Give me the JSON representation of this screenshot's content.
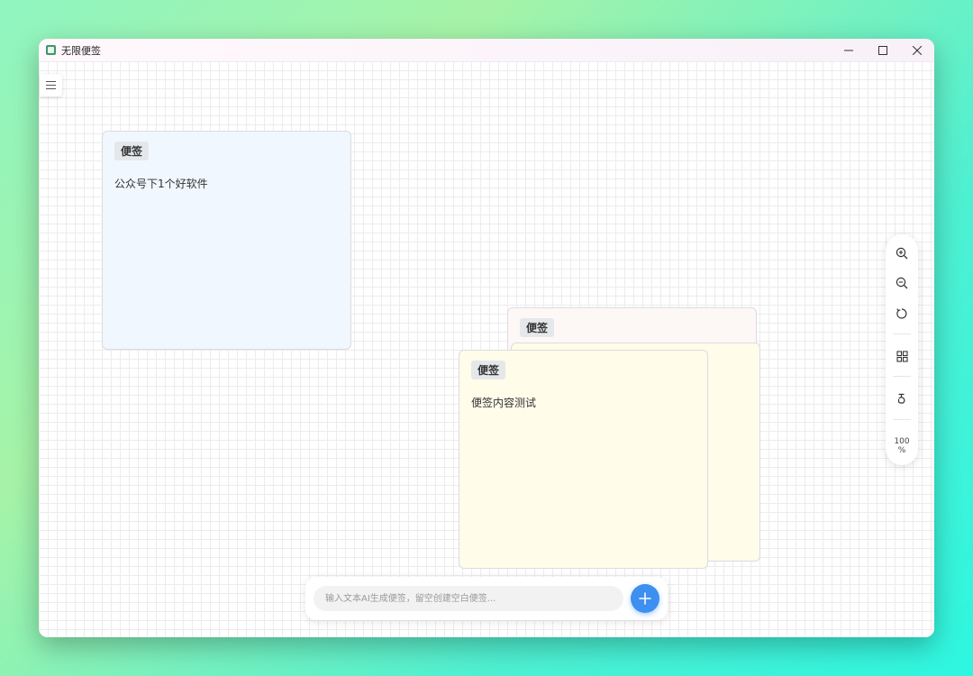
{
  "window": {
    "title": "无限便签"
  },
  "notes": [
    {
      "tag": "便签",
      "text": "公众号下1个好软件",
      "bg": "#f0f7fe"
    },
    {
      "tag": "便签",
      "text": "",
      "bg": "#fdf8f6"
    },
    {
      "tag": "",
      "text": "",
      "bg": "#fffcea"
    },
    {
      "tag": "便签",
      "text": "便签内容测试",
      "bg": "#fffcea"
    }
  ],
  "toolbar": {
    "zoom_value": "100",
    "zoom_unit": "%"
  },
  "input": {
    "placeholder": "输入文本AI生成便签，留空创建空白便签..."
  },
  "colors": {
    "accent": "#3d8ff0"
  }
}
